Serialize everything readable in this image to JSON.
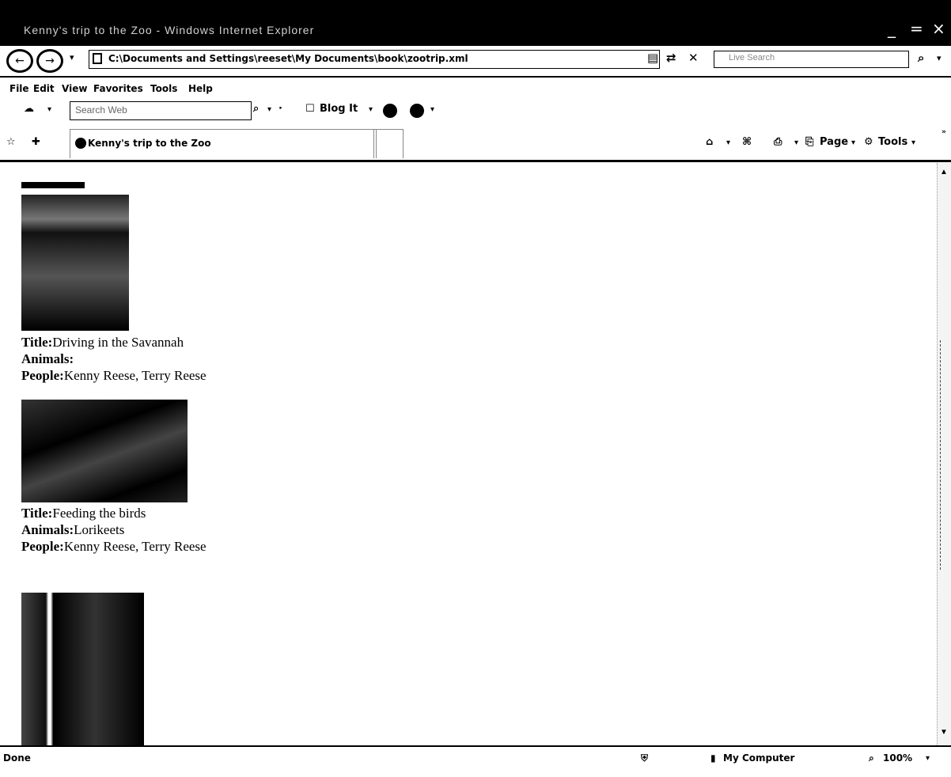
{
  "window": {
    "title": "Kenny's trip to the Zoo - Windows Internet Explorer"
  },
  "address_bar": {
    "url": "C:\\Documents and Settings\\reeset\\My Documents\\book\\zootrip.xml",
    "live_search_placeholder": "Live Search"
  },
  "menu": [
    "File",
    "Edit",
    "View",
    "Favorites",
    "Tools",
    "Help"
  ],
  "toolbar": {
    "search_placeholder": "Search Web",
    "blog_it": "Blog It"
  },
  "tab": {
    "label": "Kenny's trip to the Zoo"
  },
  "command_bar": {
    "page": "Page",
    "tools": "Tools"
  },
  "entries": [
    {
      "title_label": "Title:",
      "title": "Driving in the Savannah",
      "animals_label": "Animals:",
      "animals": "",
      "people_label": "People:",
      "people": "Kenny Reese, Terry Reese"
    },
    {
      "title_label": "Title:",
      "title": "Feeding the birds",
      "animals_label": "Animals:",
      "animals": "Lorikeets",
      "people_label": "People:",
      "people": "Kenny Reese, Terry Reese"
    }
  ],
  "status_bar": {
    "status": "Done",
    "zone": "My Computer",
    "zoom": "100%"
  },
  "colors": {
    "chrome": "#000000",
    "background": "#ffffff"
  }
}
